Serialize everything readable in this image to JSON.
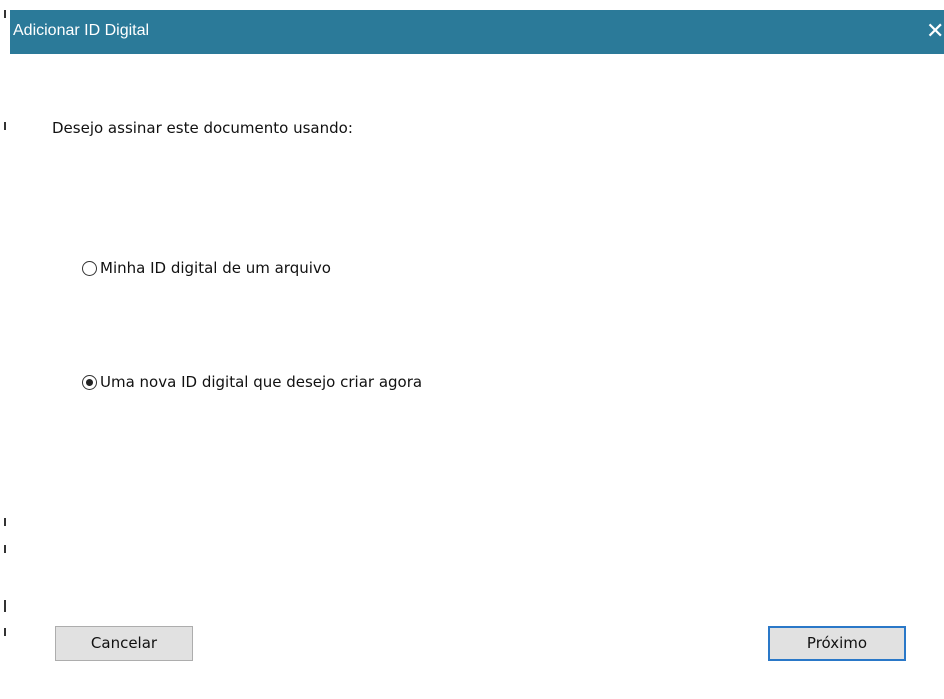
{
  "dialog": {
    "title": "Adicionar ID Digital",
    "close_glyph": "✕",
    "prompt": "Desejo assinar este documento usando:",
    "options": [
      {
        "label": "Minha ID digital de um arquivo",
        "checked": false
      },
      {
        "label": "Uma nova ID digital que desejo criar agora",
        "checked": true
      }
    ],
    "buttons": {
      "cancel": "Cancelar",
      "next": "Próximo"
    }
  },
  "colors": {
    "titlebar": "#2b7a99",
    "focus_border": "#2a78c8"
  },
  "icons": {
    "close": "close-icon"
  }
}
